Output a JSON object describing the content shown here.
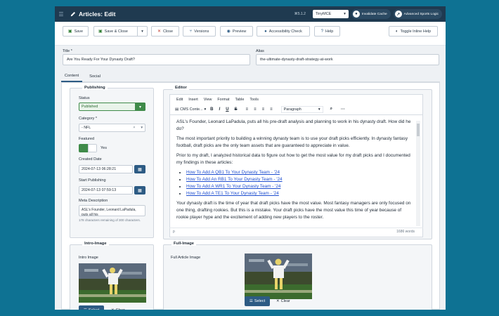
{
  "header": {
    "title": "Articles: Edit",
    "version": "⌘5.1.2",
    "editor_select": "TinyMCE",
    "invalidate_cache": "Invalidate Cache",
    "site_link": "Advanced Sports Logic"
  },
  "toolbar": {
    "save": "Save",
    "save_close": "Save & Close",
    "close": "Close",
    "versions": "Versions",
    "preview": "Preview",
    "accessibility": "Accessibility Check",
    "help": "Help",
    "toggle_inline_help": "Toggle Inline Help"
  },
  "form": {
    "title_label": "Title *",
    "title_value": "Are You Ready For Your Dynasty Draft?",
    "alias_label": "Alias",
    "alias_value": "the-ultimate-dynasty-draft-strategy-at-work"
  },
  "tabs": [
    "Content",
    "Social"
  ],
  "publishing": {
    "legend": "Publishing",
    "status_label": "Status",
    "status_value": "Published",
    "category_label": "Category *",
    "category_value": "- NFL",
    "featured_label": "Featured",
    "featured_value": "Yes",
    "created_label": "Created Date",
    "created_value": "2024-07-13 06:28:21",
    "start_label": "Start Publishing",
    "start_value": "2024-07-13 07:59:13",
    "meta_label": "Meta Description",
    "meta_value": "ASL's Founder, Leonard LaPadula, puts all his",
    "meta_hint": "178 characters remaining of 300 characters."
  },
  "editor": {
    "legend": "Editor",
    "menu": [
      "Edit",
      "Insert",
      "View",
      "Format",
      "Table",
      "Tools"
    ],
    "cms_content": "CMS Conte...",
    "paragraph_select": "Paragraph",
    "paragraphs": [
      "ASL's Founder, Leonard LaPadula, puts all his pre-draft analysis and planning to work in his dynasty draft. How did he do?",
      "The most important priority to building a winning dynasty team is to use your draft picks efficiently. In dynasty fantasy football, draft picks are the only team assets that are guaranteed to appreciate in value.",
      "Prior to my draft, I analyzed historical data to figure out how to get the most value for my draft picks and I documented my findings in these articles:"
    ],
    "links": [
      "How To Add A QB1 To Your Dynasty Team - '24",
      "How To Add An RB1 To Your Dynasty Team - '24",
      "How To Add A WR1 To Your Dynasty Team - '24",
      "How To Add A TE1 To Your Dynasty Team - '24"
    ],
    "closing_paragraph": "Your dynasty draft is the time of year that draft picks have the most value. Most fantasy managers are only focused on one thing, drafting rookies. But this is a mistake. Your draft picks have the most value this time of year because of rookie player hype and the excitement of adding new players to the roster.",
    "status_path": "p",
    "word_count": "1686 words"
  },
  "images": {
    "intro_legend": "Intro-Image",
    "intro_label": "Intro Image",
    "full_legend": "Full-Image",
    "full_label": "Full Article Image",
    "select": "Select",
    "clear": "Clear"
  },
  "colors": {
    "page_bg": "#0e7293",
    "header_bg": "#1f3a50",
    "accent": "#2d5b84",
    "success": "#3f8b49"
  }
}
